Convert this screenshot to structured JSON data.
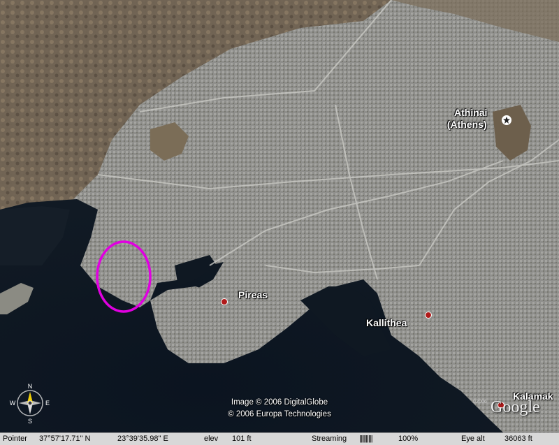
{
  "map": {
    "places": {
      "athens": {
        "line1": "Athinai",
        "line2": "(Athens)"
      },
      "pireas": "Pireas",
      "kallithea": "Kallithea",
      "kalamaki": "Kalamak"
    },
    "imagery_credit": "Image © 2006 DigitalGlobe",
    "data_credit": "© 2006 Europa Technologies",
    "logo": "Google",
    "logo_small_copy": "©2006",
    "compass_letters": {
      "n": "N",
      "s": "S",
      "e": "E",
      "w": "W"
    },
    "highlight_color": "#e000e0"
  },
  "status_bar": {
    "pointer_label": "Pointer",
    "pointer_lat": "37°57'17.71\"  N",
    "pointer_lon": "23°39'35.98\"  E",
    "elev_label": "elev",
    "elev_value": "101 ft",
    "streaming_label": "Streaming",
    "streaming_bars": "||||||||||",
    "streaming_percent": "100%",
    "eye_alt_label": "Eye  alt",
    "eye_alt_value": "36063 ft"
  }
}
